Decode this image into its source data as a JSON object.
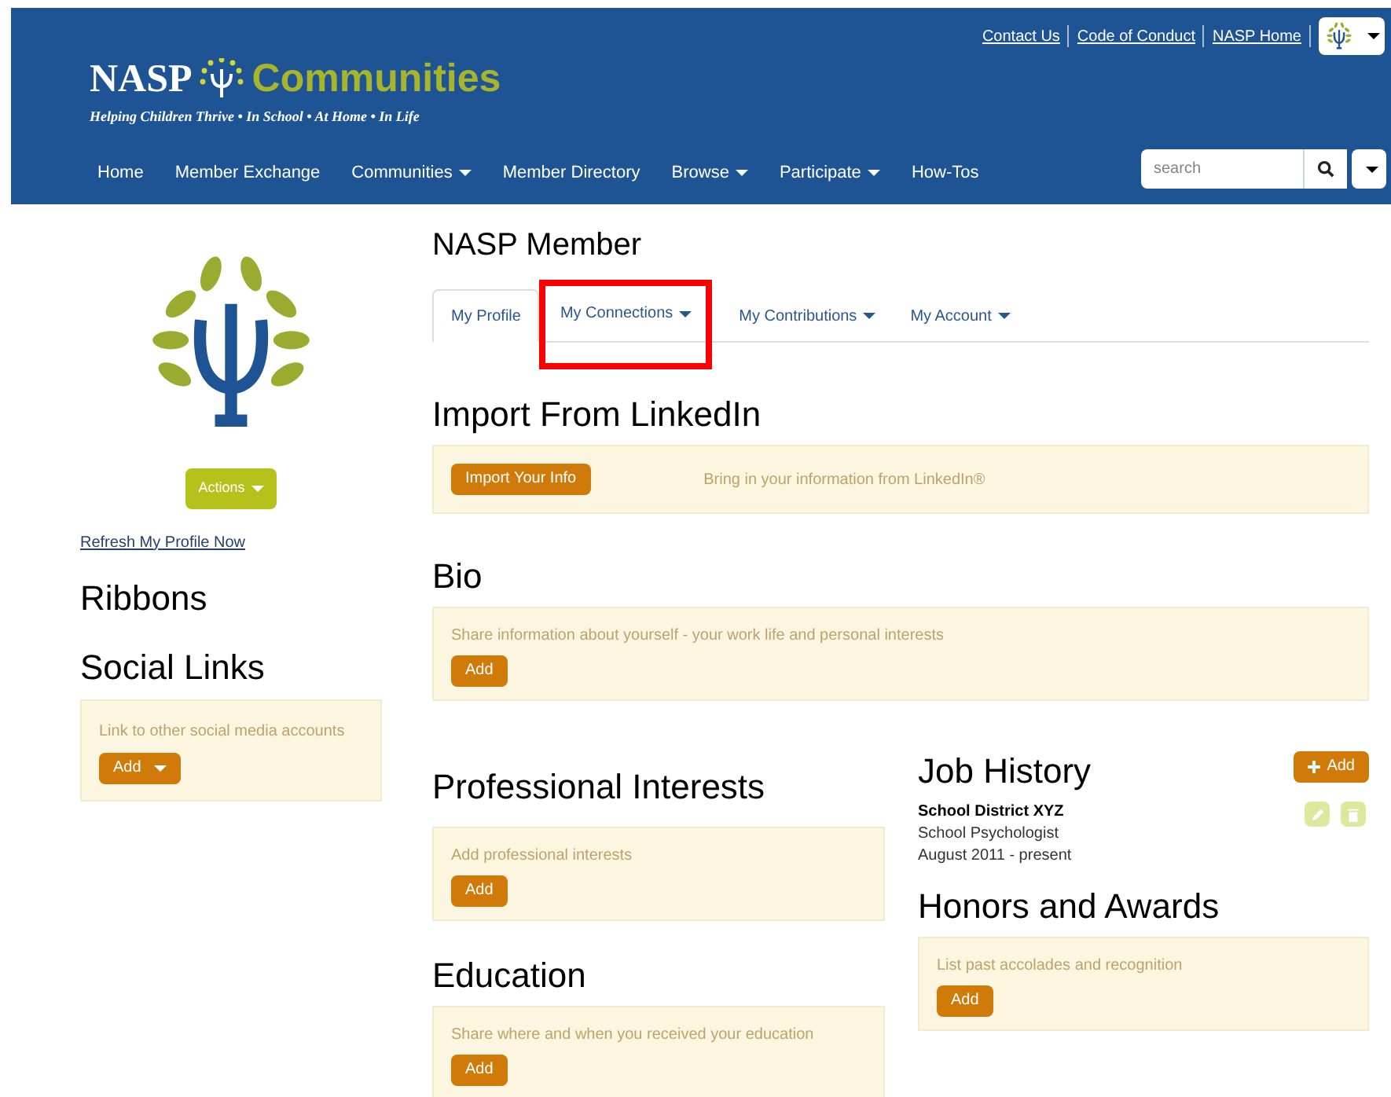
{
  "top_links": [
    "Contact Us",
    "Code of Conduct",
    "NASP Home"
  ],
  "brand": {
    "name": "NASP",
    "product": "Communities",
    "tagline": "Helping Children Thrive • In School • At Home • In Life"
  },
  "nav": [
    {
      "label": "Home",
      "dropdown": false
    },
    {
      "label": "Member Exchange",
      "dropdown": false
    },
    {
      "label": "Communities",
      "dropdown": true
    },
    {
      "label": "Member Directory",
      "dropdown": false
    },
    {
      "label": "Browse",
      "dropdown": true
    },
    {
      "label": "Participate",
      "dropdown": true
    },
    {
      "label": "How-Tos",
      "dropdown": false
    }
  ],
  "search": {
    "placeholder": "search"
  },
  "sidebar": {
    "actions_button": "Actions",
    "refresh_link": "Refresh My Profile Now",
    "ribbons_title": "Ribbons",
    "social_links": {
      "title": "Social Links",
      "text": "Link to other social media accounts",
      "button": "Add"
    }
  },
  "page_title": "NASP Member",
  "tabs": [
    {
      "label": "My Profile",
      "selected": true,
      "highlighted": false
    },
    {
      "label": "My Connections",
      "selected": false,
      "highlighted": true
    },
    {
      "label": "My Contributions",
      "selected": false,
      "highlighted": false
    },
    {
      "label": "My Account",
      "selected": false,
      "highlighted": false
    }
  ],
  "import": {
    "title": "Import From LinkedIn",
    "button": "Import Your Info",
    "text": "Bring in your information from LinkedIn®"
  },
  "bio": {
    "title": "Bio",
    "text": "Share information about yourself - your work life and personal interests",
    "button": "Add"
  },
  "professional_interests": {
    "title": "Professional Interests",
    "text": "Add professional interests",
    "button": "Add"
  },
  "education": {
    "title": "Education",
    "text": "Share where and when you received your education",
    "button": "Add"
  },
  "job_history": {
    "title": "Job History",
    "add_button": "Add",
    "entries": [
      {
        "employer": "School District XYZ",
        "title": "School Psychologist",
        "dates": "August 2011 - present"
      }
    ]
  },
  "honors": {
    "title": "Honors and Awards",
    "text": "List past accolades and recognition",
    "button": "Add"
  }
}
